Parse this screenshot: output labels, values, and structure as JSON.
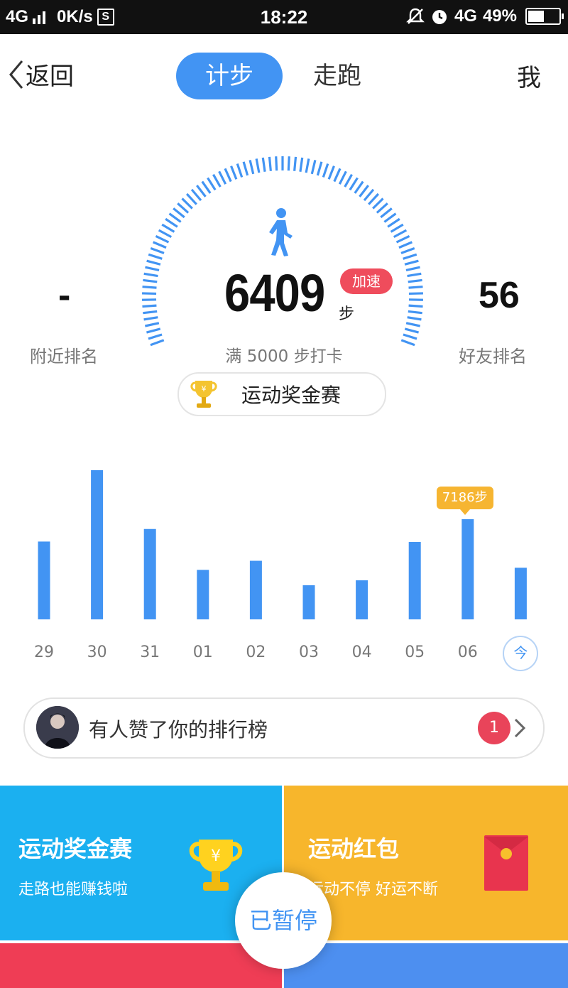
{
  "status_bar": {
    "network_left": "4G",
    "speed": "0K/s",
    "s_badge": "S",
    "time": "18:22",
    "network_right": "4G",
    "battery": "49%"
  },
  "nav": {
    "back_label": "返回",
    "tabs": [
      {
        "label": "计步",
        "active": true
      },
      {
        "label": "走跑",
        "active": false
      }
    ],
    "me_label": "我"
  },
  "gauge": {
    "steps": "6409",
    "unit": "步",
    "speedup": "加速",
    "goal_text": "满 5000 步打卡",
    "nearby_value": "-",
    "nearby_label": "附近排名",
    "friend_value": "56",
    "friend_label": "好友排名",
    "icon": "walking-person-icon",
    "accent_color": "#4294f3"
  },
  "contest_pill": {
    "label": "运动奖金赛",
    "icon": "trophy-icon"
  },
  "chart_data": {
    "type": "bar",
    "categories": [
      "29",
      "30",
      "31",
      "01",
      "02",
      "03",
      "04",
      "05",
      "06"
    ],
    "values": [
      5580,
      10700,
      6480,
      3550,
      4200,
      2450,
      2800,
      5550,
      7186
    ],
    "today_label": "今",
    "today_value": 3700,
    "tooltip": "7186步",
    "highlight_index": 8,
    "ylim": [
      0,
      11000
    ],
    "bar_color": "#4294f3",
    "grid": false
  },
  "notice": {
    "text": "有人赞了你的排行榜",
    "count": "1"
  },
  "cards": {
    "contest": {
      "title": "运动奖金赛",
      "subtitle": "走路也能赚钱啦",
      "color": "#1bb0f0"
    },
    "redpacket": {
      "title": "运动红包",
      "subtitle": "运动不停 好运不断",
      "color": "#f7b62c"
    }
  },
  "pause_button": {
    "label": "已暂停"
  }
}
